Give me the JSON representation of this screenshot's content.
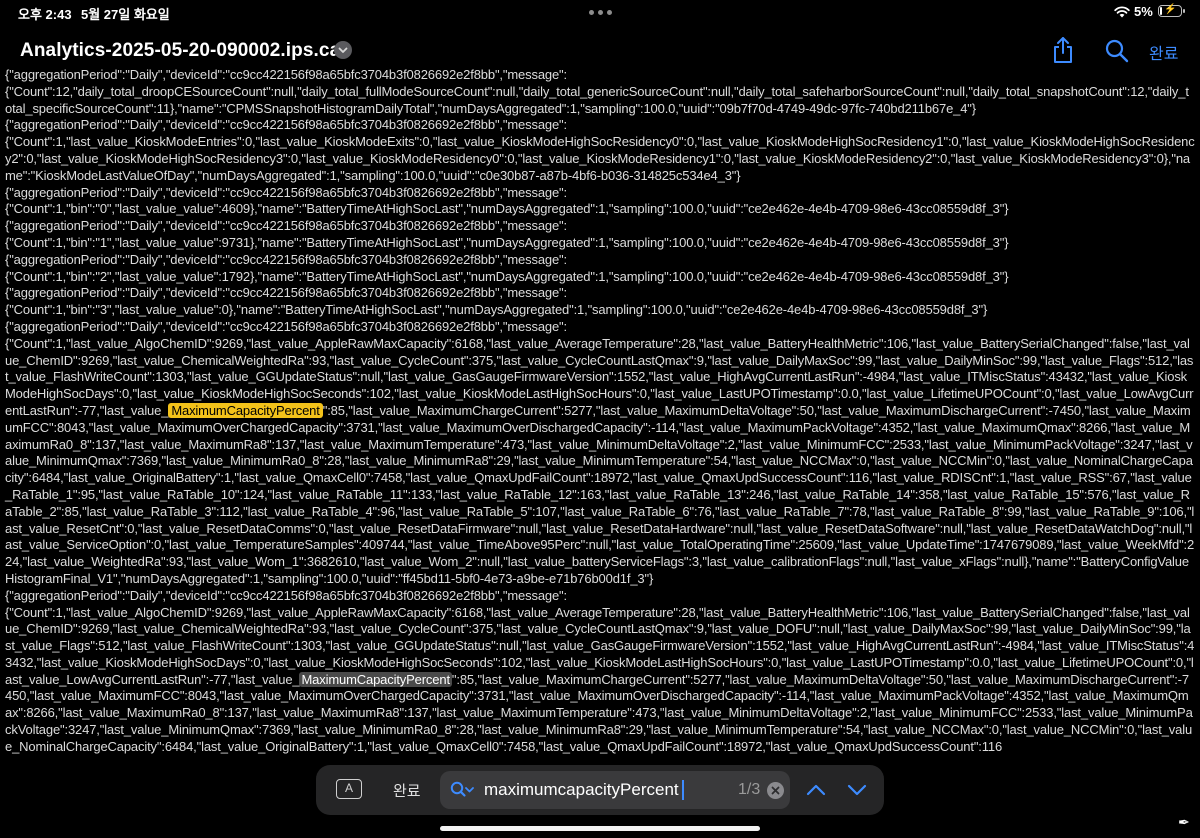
{
  "status_bar": {
    "time": "오후 2:43",
    "date": "5월 27일 화요일",
    "battery_percent": "5%",
    "battery_level": 0.05,
    "icons": [
      "wifi-icon",
      "battery-icon",
      "multitasking-dots-icon"
    ]
  },
  "toolbar": {
    "title": "Analytics-2025-05-20-090002.ips.ca",
    "done_label": "완료",
    "icons": [
      "share-icon",
      "search-icon",
      "chevron-down-icon"
    ],
    "accent_color": "#3d8bff"
  },
  "log": {
    "before_current": "{\"aggregationPeriod\":\"Daily\",\"deviceId\":\"cc9cc422156f98a65bfc3704b3f0826692e2f8bb\",\"message\":\n{\"Count\":12,\"daily_total_droopCESourceCount\":null,\"daily_total_fullModeSourceCount\":null,\"daily_total_genericSourceCount\":null,\"daily_total_safeharborSourceCount\":null,\"daily_total_snapshotCount\":12,\"daily_total_specificSourceCount\":11},\"name\":\"CPMSSnapshotHistogramDailyTotal\",\"numDaysAggregated\":1,\"sampling\":100.0,\"uuid\":\"09b7f70d-4749-49dc-97fc-740bd211b67e_4\"}\n{\"aggregationPeriod\":\"Daily\",\"deviceId\":\"cc9cc422156f98a65bfc3704b3f0826692e2f8bb\",\"message\":\n{\"Count\":1,\"last_value_KioskModeEntries\":0,\"last_value_KioskModeExits\":0,\"last_value_KioskModeHighSocResidency0\":0,\"last_value_KioskModeHighSocResidency1\":0,\"last_value_KioskModeHighSocResidency2\":0,\"last_value_KioskModeHighSocResidency3\":0,\"last_value_KioskModeResidency0\":0,\"last_value_KioskModeResidency1\":0,\"last_value_KioskModeResidency2\":0,\"last_value_KioskModeResidency3\":0},\"name\":\"KioskModeLastValueOfDay\",\"numDaysAggregated\":1,\"sampling\":100.0,\"uuid\":\"c0e30b87-a87b-4bf6-b036-314825c534e4_3\"}\n{\"aggregationPeriod\":\"Daily\",\"deviceId\":\"cc9cc422156f98a65bfc3704b3f0826692e2f8bb\",\"message\":\n{\"Count\":1,\"bin\":\"0\",\"last_value_value\":4609},\"name\":\"BatteryTimeAtHighSocLast\",\"numDaysAggregated\":1,\"sampling\":100.0,\"uuid\":\"ce2e462e-4e4b-4709-98e6-43cc08559d8f_3\"}\n{\"aggregationPeriod\":\"Daily\",\"deviceId\":\"cc9cc422156f98a65bfc3704b3f0826692e2f8bb\",\"message\":\n{\"Count\":1,\"bin\":\"1\",\"last_value_value\":9731},\"name\":\"BatteryTimeAtHighSocLast\",\"numDaysAggregated\":1,\"sampling\":100.0,\"uuid\":\"ce2e462e-4e4b-4709-98e6-43cc08559d8f_3\"}\n{\"aggregationPeriod\":\"Daily\",\"deviceId\":\"cc9cc422156f98a65bfc3704b3f0826692e2f8bb\",\"message\":\n{\"Count\":1,\"bin\":\"2\",\"last_value_value\":1792},\"name\":\"BatteryTimeAtHighSocLast\",\"numDaysAggregated\":1,\"sampling\":100.0,\"uuid\":\"ce2e462e-4e4b-4709-98e6-43cc08559d8f_3\"}\n{\"aggregationPeriod\":\"Daily\",\"deviceId\":\"cc9cc422156f98a65bfc3704b3f0826692e2f8bb\",\"message\":\n{\"Count\":1,\"bin\":\"3\",\"last_value_value\":0},\"name\":\"BatteryTimeAtHighSocLast\",\"numDaysAggregated\":1,\"sampling\":100.0,\"uuid\":\"ce2e462e-4e4b-4709-98e6-43cc08559d8f_3\"}\n{\"aggregationPeriod\":\"Daily\",\"deviceId\":\"cc9cc422156f98a65bfc3704b3f0826692e2f8bb\",\"message\":\n{\"Count\":1,\"last_value_AlgoChemID\":9269,\"last_value_AppleRawMaxCapacity\":6168,\"last_value_AverageTemperature\":28,\"last_value_BatteryHealthMetric\":106,\"last_value_BatterySerialChanged\":false,\"last_value_ChemID\":9269,\"last_value_ChemicalWeightedRa\":93,\"last_value_CycleCount\":375,\"last_value_CycleCountLastQmax\":9,\"last_value_DailyMaxSoc\":99,\"last_value_DailyMinSoc\":99,\"last_value_Flags\":512,\"last_value_FlashWriteCount\":1303,\"last_value_GGUpdateStatus\":null,\"last_value_GasGaugeFirmwareVersion\":1552,\"last_value_HighAvgCurrentLastRun\":-4984,\"last_value_ITMiscStatus\":43432,\"last_value_KioskModeHighSocDays\":0,\"last_value_KioskModeHighSocSeconds\":102,\"last_value_KioskModeLastHighSocHours\":0,\"last_value_LastUPOTimestamp\":0.0,\"last_value_LifetimeUPOCount\":0,\"last_value_LowAvgCurrentLastRun\":-77,\"last_value_",
    "current_match": "MaximumCapacityPercent",
    "between_matches": "\":85,\"last_value_MaximumChargeCurrent\":5277,\"last_value_MaximumDeltaVoltage\":50,\"last_value_MaximumDischargeCurrent\":-7450,\"last_value_MaximumFCC\":8043,\"last_value_MaximumOverChargedCapacity\":3731,\"last_value_MaximumOverDischargedCapacity\":-114,\"last_value_MaximumPackVoltage\":4352,\"last_value_MaximumQmax\":8266,\"last_value_MaximumRa0_8\":137,\"last_value_MaximumRa8\":137,\"last_value_MaximumTemperature\":473,\"last_value_MinimumDeltaVoltage\":2,\"last_value_MinimumFCC\":2533,\"last_value_MinimumPackVoltage\":3247,\"last_value_MinimumQmax\":7369,\"last_value_MinimumRa0_8\":28,\"last_value_MinimumRa8\":29,\"last_value_MinimumTemperature\":54,\"last_value_NCCMax\":0,\"last_value_NCCMin\":0,\"last_value_NominalChargeCapacity\":6484,\"last_value_OriginalBattery\":1,\"last_value_QmaxCell0\":7458,\"last_value_QmaxUpdFailCount\":18972,\"last_value_QmaxUpdSuccessCount\":116,\"last_value_RDISCnt\":1,\"last_value_RSS\":67,\"last_value_RaTable_1\":95,\"last_value_RaTable_10\":124,\"last_value_RaTable_11\":133,\"last_value_RaTable_12\":163,\"last_value_RaTable_13\":246,\"last_value_RaTable_14\":358,\"last_value_RaTable_15\":576,\"last_value_RaTable_2\":85,\"last_value_RaTable_3\":112,\"last_value_RaTable_4\":96,\"last_value_RaTable_5\":107,\"last_value_RaTable_6\":76,\"last_value_RaTable_7\":78,\"last_value_RaTable_8\":99,\"last_value_RaTable_9\":106,\"last_value_ResetCnt\":0,\"last_value_ResetDataComms\":0,\"last_value_ResetDataFirmware\":null,\"last_value_ResetDataHardware\":null,\"last_value_ResetDataSoftware\":null,\"last_value_ResetDataWatchDog\":null,\"last_value_ServiceOption\":0,\"last_value_TemperatureSamples\":409744,\"last_value_TimeAbove95Perc\":null,\"last_value_TotalOperatingTime\":25609,\"last_value_UpdateTime\":1747679089,\"last_value_WeekMfd\":224,\"last_value_WeightedRa\":93,\"last_value_Wom_1\":3682610,\"last_value_Wom_2\":null,\"last_value_batteryServiceFlags\":3,\"last_value_calibrationFlags\":null,\"last_value_xFlags\":null},\"name\":\"BatteryConfigValueHistogramFinal_V1\",\"numDaysAggregated\":1,\"sampling\":100.0,\"uuid\":\"ff45bd11-5bf0-4e73-a9be-e71b76b00d1f_3\"}\n{\"aggregationPeriod\":\"Daily\",\"deviceId\":\"cc9cc422156f98a65bfc3704b3f0826692e2f8bb\",\"message\":\n{\"Count\":1,\"last_value_AlgoChemID\":9269,\"last_value_AppleRawMaxCapacity\":6168,\"last_value_AverageTemperature\":28,\"last_value_BatteryHealthMetric\":106,\"last_value_BatterySerialChanged\":false,\"last_value_ChemID\":9269,\"last_value_ChemicalWeightedRa\":93,\"last_value_CycleCount\":375,\"last_value_CycleCountLastQmax\":9,\"last_value_DOFU\":null,\"last_value_DailyMaxSoc\":99,\"last_value_DailyMinSoc\":99,\"last_value_Flags\":512,\"last_value_FlashWriteCount\":1303,\"last_value_GGUpdateStatus\":null,\"last_value_GasGaugeFirmwareVersion\":1552,\"last_value_HighAvgCurrentLastRun\":-4984,\"last_value_ITMiscStatus\":43432,\"last_value_KioskModeHighSocDays\":0,\"last_value_KioskModeHighSocSeconds\":102,\"last_value_KioskModeLastHighSocHours\":0,\"last_value_LastUPOTimestamp\":0.0,\"last_value_LifetimeUPOCount\":0,\"last_value_LowAvgCurrentLastRun\":-77,\"last_value_",
    "other_match": "MaximumCapacityPercent",
    "after_matches": "\":85,\"last_value_MaximumChargeCurrent\":5277,\"last_value_MaximumDeltaVoltage\":50,\"last_value_MaximumDischargeCurrent\":-7450,\"last_value_MaximumFCC\":8043,\"last_value_MaximumOverChargedCapacity\":3731,\"last_value_MaximumOverDischargedCapacity\":-114,\"last_value_MaximumPackVoltage\":4352,\"last_value_MaximumQmax\":8266,\"last_value_MaximumRa0_8\":137,\"last_value_MaximumRa8\":137,\"last_value_MaximumTemperature\":473,\"last_value_MinimumDeltaVoltage\":2,\"last_value_MinimumFCC\":2533,\"last_value_MinimumPackVoltage\":3247,\"last_value_MinimumQmax\":7369,\"last_value_MinimumRa0_8\":28,\"last_value_MinimumRa8\":29,\"last_value_MinimumTemperature\":54,\"last_value_NCCMax\":0,\"last_value_NCCMin\":0,\"last_value_NominalChargeCapacity\":6484,\"last_value_OriginalBattery\":1,\"last_value_QmaxCell0\":7458,\"last_value_QmaxUpdFailCount\":18972,\"last_value_QmaxUpdSuccessCount\":116"
  },
  "find_bar": {
    "text_options_label": "A",
    "done_label": "완료",
    "query": "maximumcapacityPercent",
    "match_counter": "1/3",
    "icons": [
      "search-options-icon",
      "clear-icon",
      "previous-match-icon",
      "next-match-icon"
    ]
  },
  "colors": {
    "background": "#000000",
    "current_match_highlight": "#f3c21a",
    "other_match_highlight": "#4a4a4a",
    "link_blue": "#3d8bff"
  }
}
